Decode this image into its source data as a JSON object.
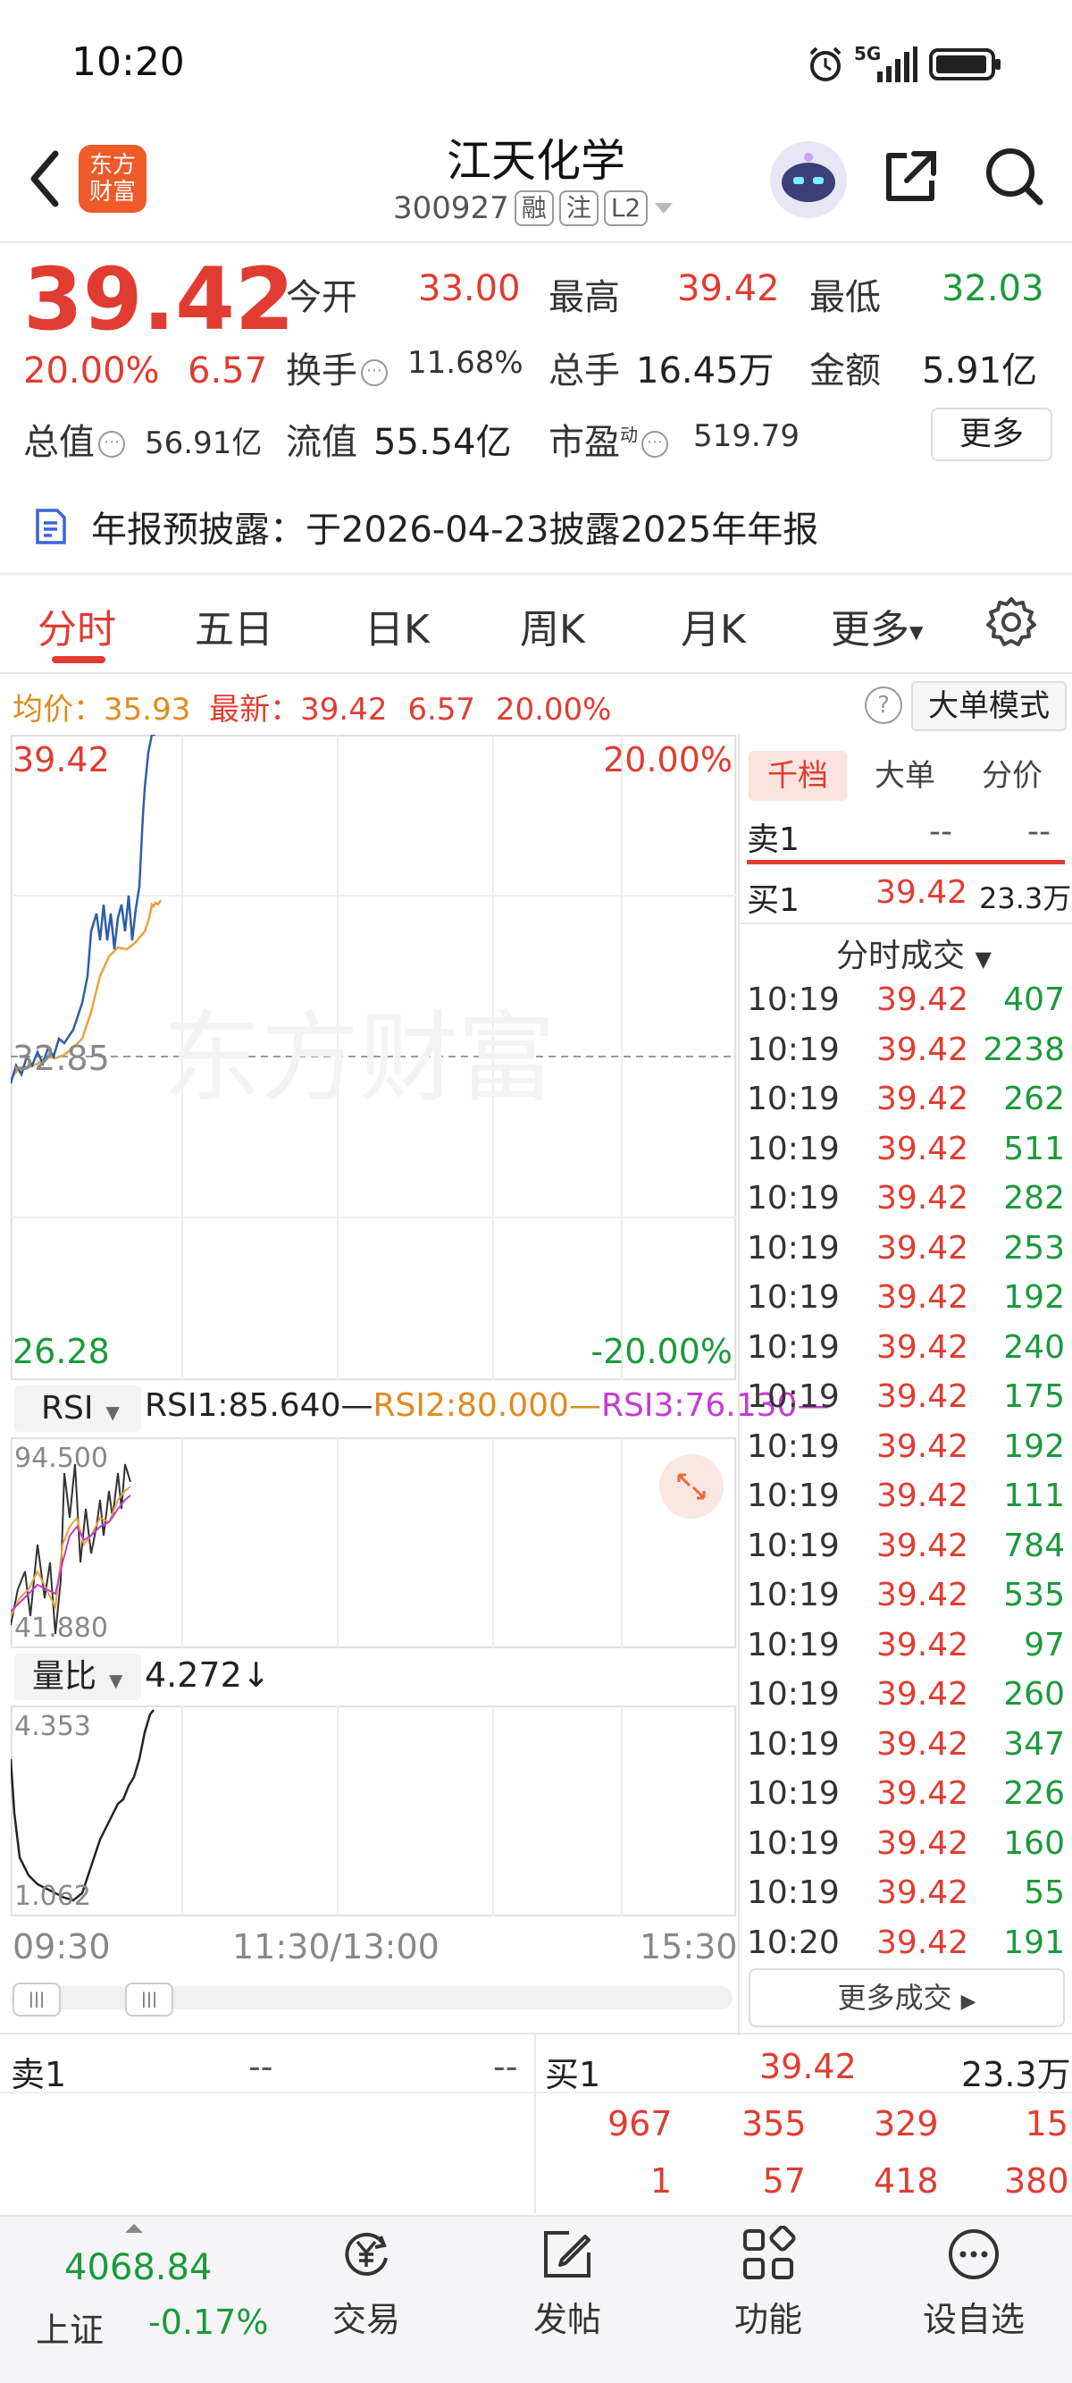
{
  "status": {
    "time": "10:20",
    "network": "5G"
  },
  "header": {
    "logo_text_1": "东方",
    "logo_text_2": "财富",
    "title": "江天化学",
    "code": "300927",
    "tags": [
      "融",
      "注",
      "L2"
    ]
  },
  "quote": {
    "price": "39.42",
    "change_pct": "20.00%",
    "change": "6.57",
    "open_label": "今开",
    "open": "33.00",
    "high_label": "最高",
    "high": "39.42",
    "low_label": "最低",
    "low": "32.03",
    "turnover_label": "换手",
    "turnover": "11.68%",
    "volume_label": "总手",
    "volume": "16.45万",
    "amount_label": "金额",
    "amount": "5.91亿",
    "mktcap_label": "总值",
    "mktcap": "56.91亿",
    "float_label": "流值",
    "float": "55.54亿",
    "pe_label": "市盈",
    "pe_sup": "动",
    "pe": "519.79",
    "more_label": "更多"
  },
  "notice": {
    "text": "年报预披露：于2026-04-23披露2025年年报"
  },
  "tabs": [
    "分时",
    "五日",
    "日K",
    "周K",
    "月K",
    "更多"
  ],
  "intraday": {
    "avg_label": "均价：",
    "avg": "35.93",
    "latest_label": "最新：",
    "latest": "39.42",
    "latest_chg": "6.57",
    "latest_pct": "20.00%",
    "bigmode_label": "大单模式",
    "y_top": "39.42",
    "y_mid": "32.85",
    "y_bot": "26.28",
    "pct_top": "20.00%",
    "pct_bot": "-20.00%",
    "watermark": "东方财富",
    "time_start": "09:30",
    "time_mid": "11:30/13:00",
    "time_end": "15:30"
  },
  "rsi": {
    "selector": "RSI",
    "rsi1": "RSI1:85.640",
    "rsi2": "RSI2:80.000",
    "rsi3": "RSI3:76.130",
    "max": "94.500",
    "min": "41.880"
  },
  "vol_ratio": {
    "selector": "量比",
    "value": "4.272↓",
    "max": "4.353",
    "min": "1.062"
  },
  "right_panel": {
    "tabs": [
      "千档",
      "大单",
      "分价"
    ],
    "sell1_label": "卖1",
    "sell1_price": "--",
    "sell1_vol": "--",
    "buy1_label": "买1",
    "buy1_price": "39.42",
    "buy1_vol": "23.3万",
    "trades_title": "分时成交",
    "trades": [
      {
        "t": "10:19",
        "p": "39.42",
        "v": "407"
      },
      {
        "t": "10:19",
        "p": "39.42",
        "v": "2238"
      },
      {
        "t": "10:19",
        "p": "39.42",
        "v": "262"
      },
      {
        "t": "10:19",
        "p": "39.42",
        "v": "511"
      },
      {
        "t": "10:19",
        "p": "39.42",
        "v": "282"
      },
      {
        "t": "10:19",
        "p": "39.42",
        "v": "253"
      },
      {
        "t": "10:19",
        "p": "39.42",
        "v": "192"
      },
      {
        "t": "10:19",
        "p": "39.42",
        "v": "240"
      },
      {
        "t": "10:19",
        "p": "39.42",
        "v": "175"
      },
      {
        "t": "10:19",
        "p": "39.42",
        "v": "192"
      },
      {
        "t": "10:19",
        "p": "39.42",
        "v": "111"
      },
      {
        "t": "10:19",
        "p": "39.42",
        "v": "784"
      },
      {
        "t": "10:19",
        "p": "39.42",
        "v": "535"
      },
      {
        "t": "10:19",
        "p": "39.42",
        "v": "97"
      },
      {
        "t": "10:19",
        "p": "39.42",
        "v": "260"
      },
      {
        "t": "10:19",
        "p": "39.42",
        "v": "347"
      },
      {
        "t": "10:19",
        "p": "39.42",
        "v": "226"
      },
      {
        "t": "10:19",
        "p": "39.42",
        "v": "160"
      },
      {
        "t": "10:19",
        "p": "39.42",
        "v": "55"
      },
      {
        "t": "10:20",
        "p": "39.42",
        "v": "191"
      }
    ],
    "more_trades": "更多成交"
  },
  "orderbook": {
    "sell1_label": "卖1",
    "sell1_price": "--",
    "sell1_vol": "--",
    "buy1_label": "买1",
    "buy1_price": "39.42",
    "buy1_vol": "23.3万",
    "queue_row1": [
      "967",
      "355",
      "329",
      "15"
    ],
    "queue_row2": [
      "1",
      "57",
      "418",
      "380"
    ]
  },
  "bottom_nav": {
    "index_value": "4068.84",
    "index_name": "上证",
    "index_chg": "-0.17%",
    "items": [
      "交易",
      "发帖",
      "功能",
      "设自选"
    ]
  },
  "colors": {
    "up": "#e03c31",
    "down": "#1a9a3a",
    "price_line": "#2c5ea8",
    "avg_line": "#e8a33a"
  }
}
